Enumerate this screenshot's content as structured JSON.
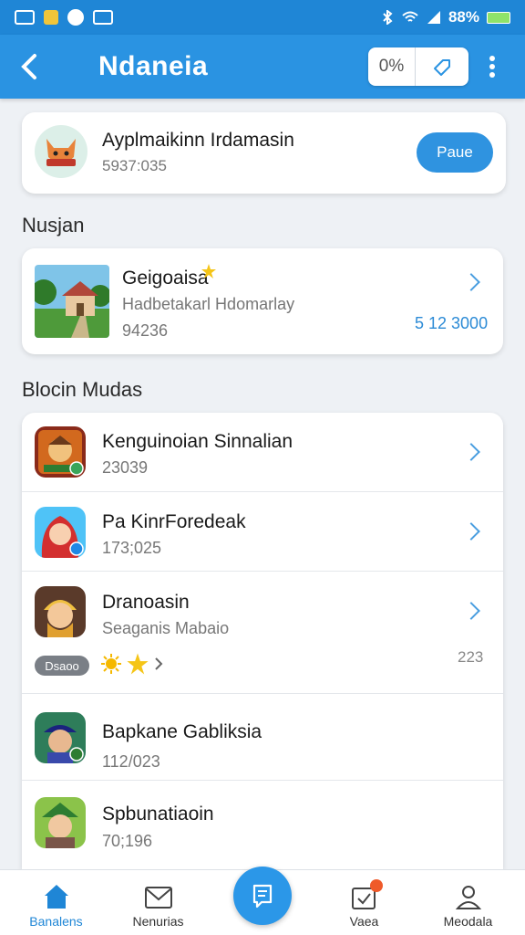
{
  "status_bar": {
    "battery": "88%"
  },
  "app_bar": {
    "title": "Ndaneia",
    "percent": "0%"
  },
  "hero": {
    "title": "Ayplmaikinn Irdamasin",
    "subtitle": "5937:035",
    "button_label": "Paue"
  },
  "section_featured": {
    "title": "Nusjan"
  },
  "featured": {
    "title": "Geigoaisa",
    "description": "Hadbetakarl Hdomarlay",
    "count": "94236",
    "value": "5 12 3000"
  },
  "section_list": {
    "title": "Blocin Mudas"
  },
  "list": [
    {
      "title": "Kenguinoian Sinnalian",
      "subtitle": "23039"
    },
    {
      "title": "Pa KinrForedeak",
      "subtitle": "173;025"
    },
    {
      "title": "Dranoasin",
      "subtitle": "Seaganis Mabaio",
      "badge": "Dsaoo",
      "value": "223"
    },
    {
      "title": "Bapkane Gabliksia",
      "subtitle": "112/023"
    },
    {
      "title": "Spbunatiaoin",
      "subtitle": "70;196"
    }
  ],
  "bottom_nav": [
    {
      "label": "Banalens"
    },
    {
      "label": "Nenurias"
    },
    {
      "label": ""
    },
    {
      "label": "Vaea"
    },
    {
      "label": "Meodala"
    }
  ],
  "colors": {
    "primary": "#2a93e2",
    "status_bar": "#1f86d6",
    "accent_badge": "#ef5a2a"
  }
}
